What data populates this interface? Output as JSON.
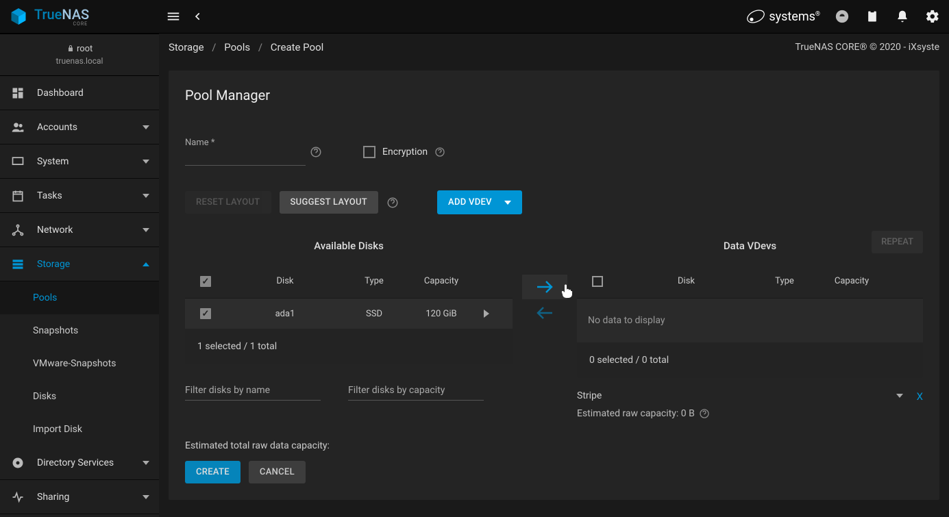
{
  "brand": {
    "true": "True",
    "nas": "NAS",
    "core": "CORE"
  },
  "topbar": {
    "ix_prefix": "iX",
    "ix_suffix": "systems",
    "reg": "®"
  },
  "user": {
    "name": "root",
    "host": "truenas.local"
  },
  "sidebar": {
    "dashboard": "Dashboard",
    "accounts": "Accounts",
    "system": "System",
    "tasks": "Tasks",
    "network": "Network",
    "storage": "Storage",
    "storage_sub": {
      "pools": "Pools",
      "snapshots": "Snapshots",
      "vmware": "VMware-Snapshots",
      "disks": "Disks",
      "import": "Import Disk"
    },
    "directory": "Directory Services",
    "sharing": "Sharing"
  },
  "breadcrumb": {
    "a": "Storage",
    "b": "Pools",
    "c": "Create Pool"
  },
  "copyright": "TrueNAS CORE® © 2020 - iXsyste",
  "page": {
    "title": "Pool Manager",
    "name_label": "Name *",
    "encryption_label": "Encryption",
    "reset_layout": "RESET LAYOUT",
    "suggest_layout": "SUGGEST LAYOUT",
    "add_vdev": "ADD VDEV",
    "available_title": "Available Disks",
    "vdev_title": "Data VDevs",
    "repeat": "REPEAT",
    "cols": {
      "disk": "Disk",
      "type": "Type",
      "capacity": "Capacity"
    },
    "disks": [
      {
        "name": "ada1",
        "type": "SSD",
        "capacity": "120 GiB"
      }
    ],
    "avail_footer": "1 selected / 1 total",
    "vdev_empty": "No data to display",
    "vdev_footer": "0 selected / 0 total",
    "filter_name_ph": "Filter disks by name",
    "filter_cap_ph": "Filter disks by capacity",
    "vdev_type": "Stripe",
    "vdev_est": "Estimated raw capacity: 0 B",
    "vdev_remove": "X",
    "est_total": "Estimated total raw data capacity:",
    "create": "CREATE",
    "cancel": "CANCEL"
  }
}
